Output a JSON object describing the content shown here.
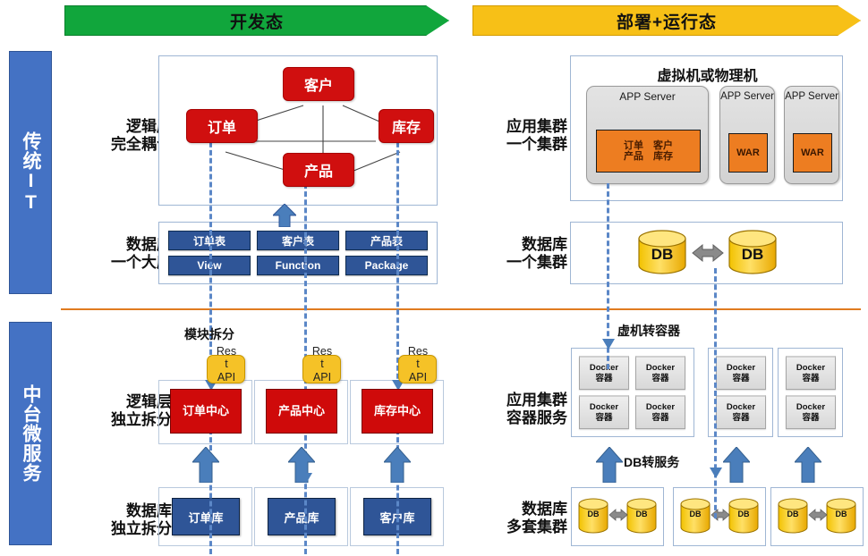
{
  "banners": {
    "dev": "开发态",
    "ops": "部署+运行态"
  },
  "rails": [
    {
      "label": "传统IT"
    },
    {
      "label": "中台微服务"
    }
  ],
  "captions": {
    "legacy_logic": {
      "line1": "逻辑层",
      "line2": "完全耦合"
    },
    "legacy_db": {
      "line1": "数据库",
      "line2": "一个大库"
    },
    "legacy_app_cluster": {
      "line1": "应用集群",
      "line2": "一个集群"
    },
    "legacy_db_cluster": {
      "line1": "数据库",
      "line2": "一个集群"
    },
    "micro_logic": {
      "line1": "逻辑层",
      "line2": "独立拆分"
    },
    "micro_db": {
      "line1": "数据库",
      "line2": "独立拆分"
    },
    "micro_app_cluster": {
      "line1": "应用集群",
      "line2": "容器服务"
    },
    "micro_db_cluster": {
      "line1": "数据库",
      "line2": "多套集群"
    }
  },
  "monolith_graph": {
    "nodes": [
      {
        "id": "customer",
        "label": "客户"
      },
      {
        "id": "order",
        "label": "订单"
      },
      {
        "id": "stock",
        "label": "库存"
      },
      {
        "id": "product",
        "label": "产品"
      }
    ]
  },
  "legacy_database": {
    "row1": [
      "订单表",
      "客户表",
      "产品表"
    ],
    "row2": [
      "View",
      "Function",
      "Package"
    ]
  },
  "vm_panel": {
    "title": "虚拟机或物理机",
    "servers": [
      {
        "title": "APP Server",
        "payload_lines": [
          "订单　客户",
          "产品　库存"
        ],
        "wide": true
      },
      {
        "title": "APP Server",
        "payload_lines": [
          "WAR"
        ],
        "wide": false
      },
      {
        "title": "APP Server",
        "payload_lines": [
          "WAR"
        ],
        "wide": false
      }
    ]
  },
  "legacy_db_cluster": {
    "nodes": [
      "DB",
      "DB"
    ]
  },
  "annotations": {
    "module_split": "模块拆分",
    "vm_to_container": "虚机转容器",
    "db_to_service": "DB转服务"
  },
  "rest_api": {
    "line1": "Res",
    "line2": "t",
    "line3": "API"
  },
  "micro_services": [
    {
      "label": "订单中心"
    },
    {
      "label": "产品中心"
    },
    {
      "label": "库存中心"
    }
  ],
  "micro_databases": [
    {
      "label": "订单库"
    },
    {
      "label": "产品库"
    },
    {
      "label": "客户库"
    }
  ],
  "container_clusters": [
    {
      "count": 4,
      "label": "Docker",
      "sub": "容器"
    },
    {
      "count": 2,
      "label": "Docker",
      "sub": "容器"
    },
    {
      "count": 2,
      "label": "Docker",
      "sub": "容器"
    }
  ],
  "db_clusters": [
    {
      "left": "DB",
      "right": "DB"
    },
    {
      "left": "DB",
      "right": "DB"
    },
    {
      "left": "DB",
      "right": "DB"
    }
  ],
  "colors": {
    "green_banner": "#11a63c",
    "yellow_banner": "#f7c017",
    "rail_blue": "#4472c4",
    "node_red": "#d00f0f",
    "db_blue": "#2f5597",
    "arrow_blue": "#4a7ebb",
    "war_orange": "#ed7d21",
    "separator_orange": "#e07b20",
    "db_cylinder": "#f5c518"
  }
}
